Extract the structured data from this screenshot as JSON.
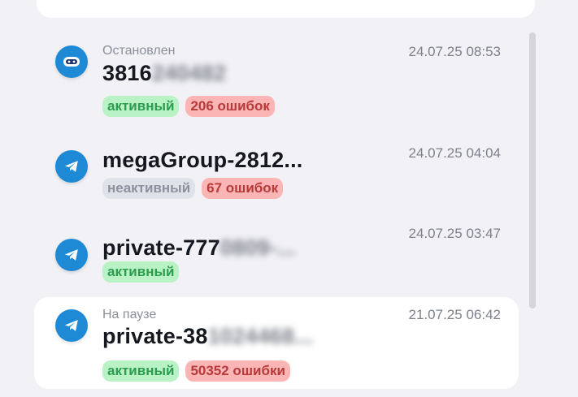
{
  "chats": [
    {
      "icon": "robot-icon",
      "status": "Остановлен",
      "title_visible": "3816",
      "title_hidden": "240482",
      "date": "24.07.25 08:53",
      "badges": [
        {
          "kind": "active",
          "label": "активный"
        },
        {
          "kind": "errors",
          "label": "206 ошибок"
        }
      ]
    },
    {
      "icon": "telegram-icon",
      "status": "",
      "title_visible": "megaGroup-2812...",
      "title_hidden": "",
      "date": "24.07.25 04:04",
      "badges": [
        {
          "kind": "inactive",
          "label": "неактивный"
        },
        {
          "kind": "errors",
          "label": "67 ошибок"
        }
      ]
    },
    {
      "icon": "telegram-icon",
      "status": "",
      "title_visible": "private-777",
      "title_hidden": "0809-...",
      "date": "24.07.25 03:47",
      "badges": [
        {
          "kind": "active",
          "label": "активный"
        }
      ]
    },
    {
      "icon": "telegram-icon",
      "status": "На паузе",
      "title_visible": "private-38",
      "title_hidden": "1024468...",
      "date": "21.07.25 06:42",
      "badges": [
        {
          "kind": "active",
          "label": "активный"
        },
        {
          "kind": "errors",
          "label": "50352 ошибки"
        }
      ]
    }
  ]
}
